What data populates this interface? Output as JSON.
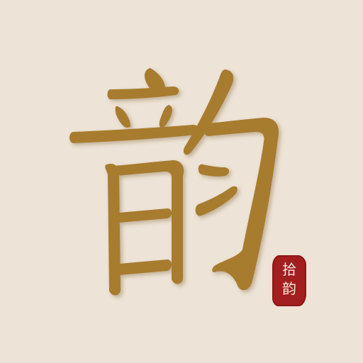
{
  "main_character": "韵",
  "seal": {
    "lines": [
      "拾",
      "韵"
    ],
    "color": "#A31E1E",
    "text_color": "#F4E7DC"
  },
  "colors": {
    "background": "#EDE3D7",
    "glyph": "#A87B2E",
    "glyph_shadow": "#7D5A23"
  }
}
